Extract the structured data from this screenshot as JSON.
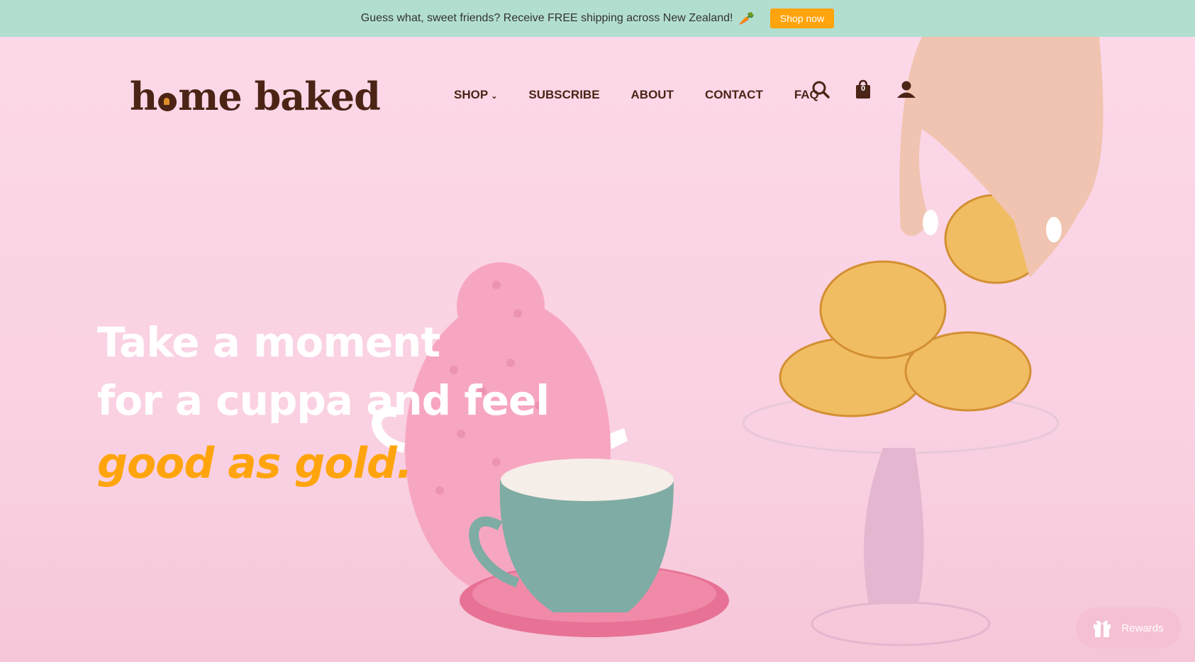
{
  "announcement": {
    "text": "Guess what, sweet friends? Receive FREE shipping across New Zealand!",
    "emoji": "🥕",
    "button_label": "Shop now",
    "bg_color": "#b2ded0",
    "button_color": "#ffa40c"
  },
  "header": {
    "logo_part1": "h",
    "logo_part2": "me baked",
    "nav": [
      {
        "label": "SHOP",
        "has_dropdown": true
      },
      {
        "label": "SUBSCRIBE"
      },
      {
        "label": "ABOUT"
      },
      {
        "label": "CONTACT"
      },
      {
        "label": "FAQ"
      }
    ],
    "cart_count": "0",
    "icons": [
      "search-icon",
      "cart-icon",
      "account-icon"
    ]
  },
  "hero": {
    "line1": "Take a moment",
    "line2": "for a cuppa and feel",
    "line3": "good as gold.",
    "accent_color": "#ffa40c"
  },
  "rewards": {
    "label": "Rewards",
    "icon": "gift-icon"
  },
  "colors": {
    "brand_brown": "#4b2416",
    "hero_bg": "#fbd6e6"
  }
}
